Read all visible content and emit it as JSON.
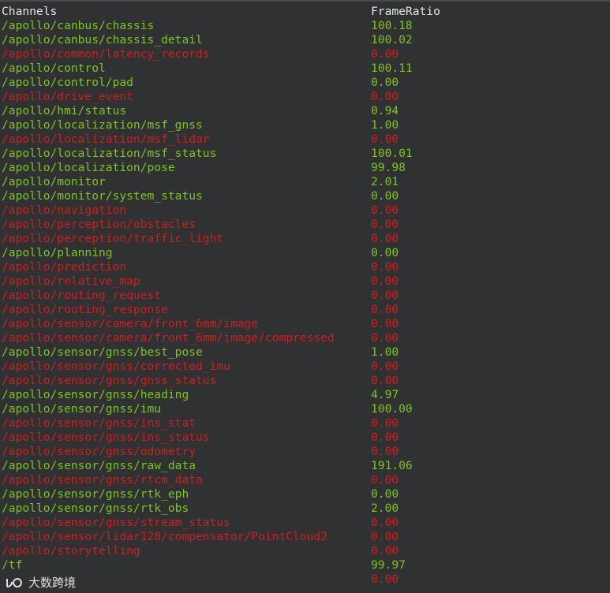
{
  "header": {
    "channels_label": "Channels",
    "frameratio_label": "FrameRatio"
  },
  "colors": {
    "ok": "#7fc51a",
    "bad": "#d11e1e",
    "header": "#e6e6e6",
    "background": "#2f3132"
  },
  "rows": [
    {
      "channel": "/apollo/canbus/chassis",
      "ratio": "100.18",
      "status": "ok"
    },
    {
      "channel": "/apollo/canbus/chassis_detail",
      "ratio": "100.02",
      "status": "ok"
    },
    {
      "channel": "/apollo/common/latency_records",
      "ratio": "0.00",
      "status": "bad"
    },
    {
      "channel": "/apollo/control",
      "ratio": "100.11",
      "status": "ok"
    },
    {
      "channel": "/apollo/control/pad",
      "ratio": "0.00",
      "status": "ok"
    },
    {
      "channel": "/apollo/drive_event",
      "ratio": "0.00",
      "status": "bad"
    },
    {
      "channel": "/apollo/hmi/status",
      "ratio": "0.94",
      "status": "ok"
    },
    {
      "channel": "/apollo/localization/msf_gnss",
      "ratio": "1.00",
      "status": "ok"
    },
    {
      "channel": "/apollo/localization/msf_lidar",
      "ratio": "0.00",
      "status": "bad"
    },
    {
      "channel": "/apollo/localization/msf_status",
      "ratio": "100.01",
      "status": "ok"
    },
    {
      "channel": "/apollo/localization/pose",
      "ratio": "99.98",
      "status": "ok"
    },
    {
      "channel": "/apollo/monitor",
      "ratio": "2.01",
      "status": "ok"
    },
    {
      "channel": "/apollo/monitor/system_status",
      "ratio": "0.00",
      "status": "ok"
    },
    {
      "channel": "/apollo/navigation",
      "ratio": "0.00",
      "status": "bad"
    },
    {
      "channel": "/apollo/perception/obstacles",
      "ratio": "0.00",
      "status": "bad"
    },
    {
      "channel": "/apollo/perception/traffic_light",
      "ratio": "0.00",
      "status": "bad"
    },
    {
      "channel": "/apollo/planning",
      "ratio": "0.00",
      "status": "ok"
    },
    {
      "channel": "/apollo/prediction",
      "ratio": "0.00",
      "status": "bad"
    },
    {
      "channel": "/apollo/relative_map",
      "ratio": "0.00",
      "status": "bad"
    },
    {
      "channel": "/apollo/routing_request",
      "ratio": "0.00",
      "status": "bad"
    },
    {
      "channel": "/apollo/routing_response",
      "ratio": "0.00",
      "status": "bad"
    },
    {
      "channel": "/apollo/sensor/camera/front_6mm/image",
      "ratio": "0.00",
      "status": "bad"
    },
    {
      "channel": "/apollo/sensor/camera/front_6mm/image/compressed",
      "ratio": "0.00",
      "status": "bad"
    },
    {
      "channel": "/apollo/sensor/gnss/best_pose",
      "ratio": "1.00",
      "status": "ok"
    },
    {
      "channel": "/apollo/sensor/gnss/corrected_imu",
      "ratio": "0.00",
      "status": "bad"
    },
    {
      "channel": "/apollo/sensor/gnss/gnss_status",
      "ratio": "0.00",
      "status": "bad"
    },
    {
      "channel": "/apollo/sensor/gnss/heading",
      "ratio": "4.97",
      "status": "ok"
    },
    {
      "channel": "/apollo/sensor/gnss/imu",
      "ratio": "100.00",
      "status": "ok"
    },
    {
      "channel": "/apollo/sensor/gnss/ins_stat",
      "ratio": "0.00",
      "status": "bad"
    },
    {
      "channel": "/apollo/sensor/gnss/ins_status",
      "ratio": "0.00",
      "status": "bad"
    },
    {
      "channel": "/apollo/sensor/gnss/odometry",
      "ratio": "0.00",
      "status": "bad"
    },
    {
      "channel": "/apollo/sensor/gnss/raw_data",
      "ratio": "191.06",
      "status": "ok"
    },
    {
      "channel": "/apollo/sensor/gnss/rtcm_data",
      "ratio": "0.00",
      "status": "bad"
    },
    {
      "channel": "/apollo/sensor/gnss/rtk_eph",
      "ratio": "0.00",
      "status": "ok"
    },
    {
      "channel": "/apollo/sensor/gnss/rtk_obs",
      "ratio": "2.00",
      "status": "ok"
    },
    {
      "channel": "/apollo/sensor/gnss/stream_status",
      "ratio": "0.00",
      "status": "bad"
    },
    {
      "channel": "/apollo/sensor/lidar128/compensator/PointCloud2",
      "ratio": "0.00",
      "status": "bad"
    },
    {
      "channel": "/apollo/storytelling",
      "ratio": "0.00",
      "status": "bad"
    },
    {
      "channel": "/tf",
      "ratio": "99.97",
      "status": "ok"
    },
    {
      "channel": "",
      "ratio": "0.00",
      "status": "bad"
    }
  ],
  "watermark": {
    "text": "大数跨境",
    "logo_icon": "watermark-logo-icon"
  }
}
